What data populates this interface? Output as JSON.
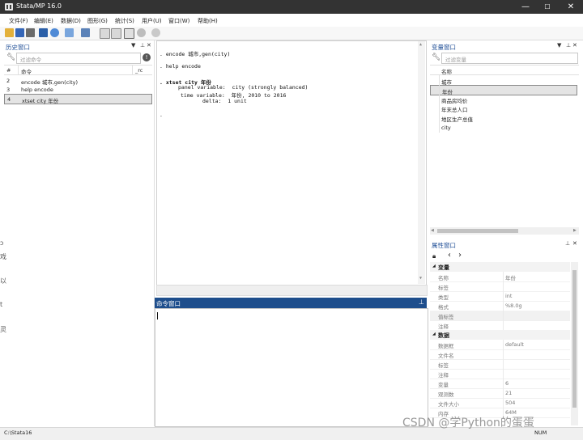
{
  "window": {
    "title": "Stata/MP 16.0",
    "min": "—",
    "max": "☐",
    "close": "✕"
  },
  "menu": [
    "文件(F)",
    "编辑(E)",
    "数据(D)",
    "图形(G)",
    "统计(S)",
    "用户(U)",
    "窗口(W)",
    "帮助(H)"
  ],
  "toolbar": {
    "icons": [
      "open-icon",
      "save-icon",
      "print-icon",
      "log-icon",
      "viewer-icon",
      "graph-icon",
      "do-file-editor-icon",
      "data-editor-icon",
      "data-browser-icon",
      "variables-manager-icon",
      "more-icon",
      "break-icon"
    ],
    "colors": {
      "folder": "#e3b03a",
      "save": "#3566b8",
      "graph": "#4f8ad6",
      "stop": "#c62828"
    }
  },
  "history": {
    "title": "历史窗口",
    "filter_placeholder": "过滤命令",
    "col_num": "#",
    "col_cmd": "命令",
    "col_rc": "_rc",
    "items": [
      {
        "n": "2",
        "cmd": "encode 城市,gen(city)"
      },
      {
        "n": "3",
        "cmd": "help encode"
      },
      {
        "n": "4",
        "cmd": "xtset city 年份"
      }
    ]
  },
  "results": {
    "lines": [
      ". encode 城市,gen(city)",
      ". help encode",
      ". xtset city 年份",
      "panel variable:  city (strongly balanced)",
      "time variable:  年份, 2010 to 2016",
      "delta:  1 unit",
      "."
    ]
  },
  "command": {
    "title": "命令窗口"
  },
  "variables": {
    "title": "变量窗口",
    "filter_placeholder": "过滤变量",
    "col_name": "名称",
    "items": [
      "城市",
      "年份",
      "商品房均价",
      "年末总人口",
      "地区生产总值",
      "city"
    ],
    "selected": "年份"
  },
  "properties": {
    "title": "属性窗口",
    "sections": [
      {
        "label": "变量",
        "rows": [
          {
            "k": "名称",
            "v": "年份"
          },
          {
            "k": "标签",
            "v": ""
          },
          {
            "k": "类型",
            "v": "int"
          },
          {
            "k": "格式",
            "v": "%8.0g"
          },
          {
            "k": "值标签",
            "v": ""
          },
          {
            "k": "注释",
            "v": ""
          }
        ]
      },
      {
        "label": "数据",
        "rows": [
          {
            "k": "数据框",
            "v": "default"
          },
          {
            "k": "文件名",
            "v": ""
          },
          {
            "k": "标签",
            "v": ""
          },
          {
            "k": "注释",
            "v": ""
          },
          {
            "k": "变量",
            "v": "6"
          },
          {
            "k": "观测数",
            "v": "21"
          },
          {
            "k": "文件大小",
            "v": "504"
          },
          {
            "k": "内存",
            "v": "64M"
          }
        ]
      }
    ]
  },
  "status": {
    "path": "C:\\Stata16",
    "num": "NUM"
  },
  "watermark": "CSDN @学Python的蛋蛋"
}
